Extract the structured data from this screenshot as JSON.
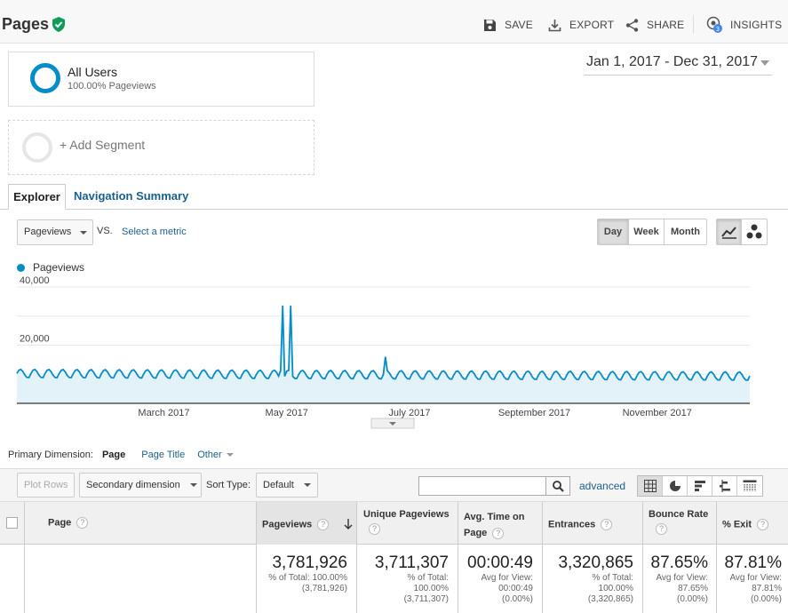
{
  "header": {
    "title": "Pages",
    "save": "SAVE",
    "export": "EXPORT",
    "share": "SHARE",
    "insights": "INSIGHTS",
    "insights_badge": "3"
  },
  "segment": {
    "name": "All Users",
    "sub": "100.00% Pageviews",
    "add": "+ Add Segment"
  },
  "date_range": "Jan 1, 2017 - Dec 31, 2017",
  "tabs": [
    "Explorer",
    "Navigation Summary"
  ],
  "controls": {
    "metric": "Pageviews",
    "vs": "VS.",
    "select_metric": "Select a metric",
    "periods": [
      "Day",
      "Week",
      "Month"
    ],
    "active_period": "Day"
  },
  "chart_data": {
    "type": "area",
    "series": [
      {
        "name": "Pageviews"
      }
    ],
    "y_ticks": [
      "40,000",
      "20,000"
    ],
    "ylim": [
      0,
      40000
    ],
    "x_labels": [
      "March 2017",
      "May 2017",
      "July 2017",
      "September 2017",
      "November 2017"
    ],
    "x_label_dates": [
      "2017-03-15",
      "2017-05-15",
      "2017-07-15",
      "2017-09-15",
      "2017-11-15"
    ],
    "x_range": [
      "2017-01-01",
      "2017-12-31"
    ],
    "baseline": 10300,
    "weekly_amplitude": 1400,
    "spikes": [
      {
        "date": "2017-05-13",
        "value": 33600
      },
      {
        "date": "2017-05-17",
        "value": 33600
      },
      {
        "date": "2017-07-03",
        "value": 16000
      }
    ],
    "color": "#058dc7"
  },
  "primary_dimension": {
    "label": "Primary Dimension:",
    "active": "Page",
    "page_title": "Page Title",
    "other": "Other"
  },
  "toolbar": {
    "plot_rows": "Plot Rows",
    "secondary": "Secondary dimension",
    "sort_type_label": "Sort Type:",
    "sort_value": "Default",
    "advanced": "advanced"
  },
  "table": {
    "columns": {
      "page": "Page",
      "pageviews": "Pageviews",
      "unique": "Unique Pageviews",
      "avg_time": "Avg. Time on Page",
      "entrances": "Entrances",
      "bounce": "Bounce Rate",
      "exit": "% Exit"
    },
    "totals": {
      "pageviews": "3,781,926",
      "pageviews_sub1": "% of Total: 100.00%",
      "pageviews_sub2": "(3,781,926)",
      "unique": "3,711,307",
      "unique_sub1": "% of Total:",
      "unique_sub2": "100.00%",
      "unique_sub3": "(3,711,307)",
      "avg_time": "00:00:49",
      "avg_time_sub1": "Avg for View:",
      "avg_time_sub2": "00:00:49",
      "avg_time_sub3": "(0.00%)",
      "entrances": "3,320,865",
      "entrances_sub1": "% of Total:",
      "entrances_sub2": "100.00%",
      "entrances_sub3": "(3,320,865)",
      "bounce": "87.65%",
      "bounce_sub1": "Avg for View:",
      "bounce_sub2": "87.65%",
      "bounce_sub3": "(0.00%)",
      "exit": "87.81%",
      "exit_sub1": "Avg for View:",
      "exit_sub2": "87.81%",
      "exit_sub3": "(0.00%)"
    },
    "help_glyph": "?"
  }
}
